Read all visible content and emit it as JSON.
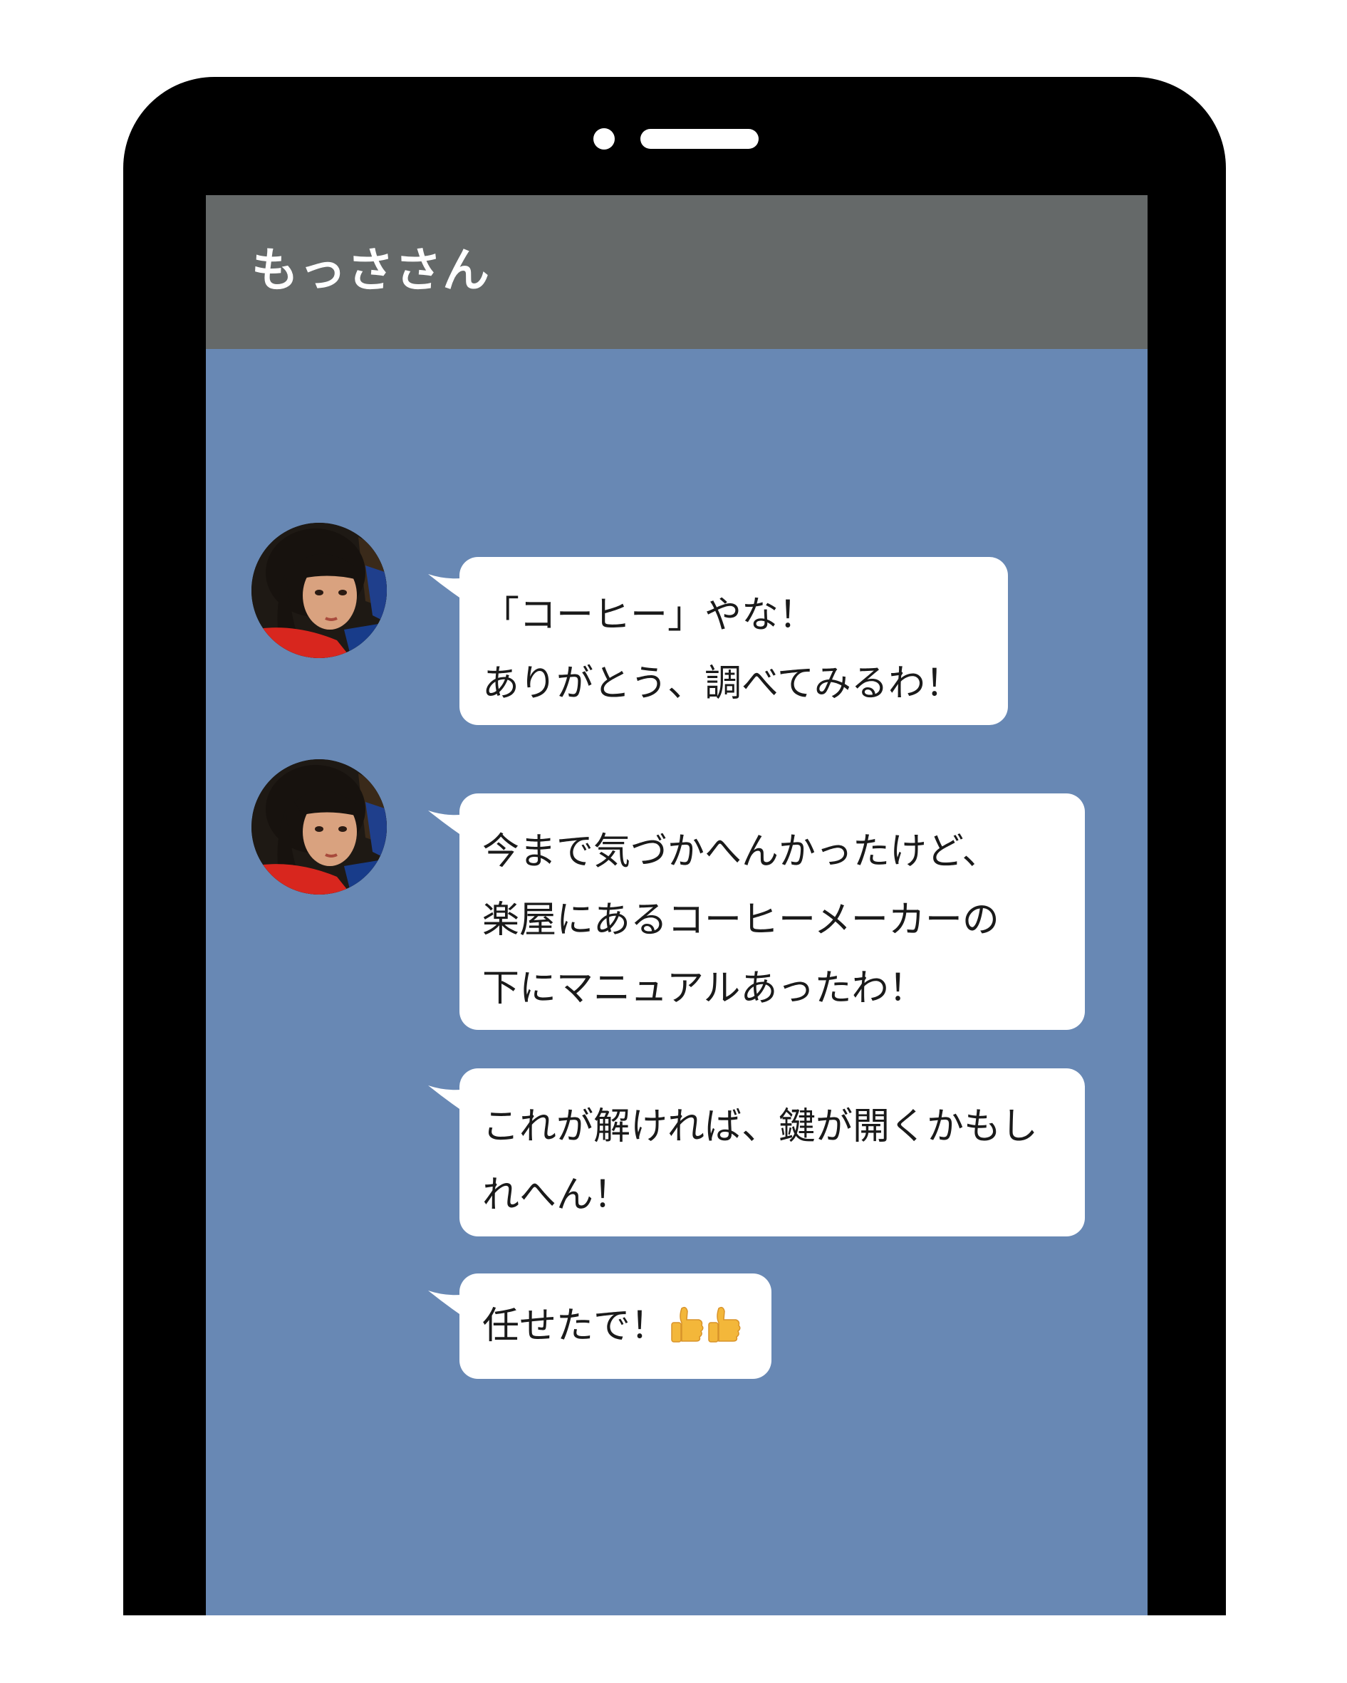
{
  "chat": {
    "contact_name": "もっささん"
  },
  "messages": [
    {
      "sender": "もっささん",
      "avatar": true,
      "lines": [
        "「コーヒー」やな！",
        "ありがとう、調べてみるわ！"
      ]
    },
    {
      "sender": "もっささん",
      "avatar": true,
      "lines": [
        "今まで気づかへんかったけど、",
        "楽屋にあるコーヒーメーカーの",
        "下にマニュアルあったわ！"
      ]
    },
    {
      "sender": "もっささん",
      "avatar": false,
      "lines": [
        "これが解ければ、鍵が開くかもし",
        "れへん！"
      ]
    },
    {
      "sender": "もっささん",
      "avatar": false,
      "lines": [
        "任せたで！"
      ],
      "emoji": [
        "thumbs-up-icon",
        "thumbs-up-icon"
      ]
    }
  ],
  "colors": {
    "device_frame": "#000000",
    "header_bg": "#656969",
    "chat_bg": "#6888b4",
    "bubble_bg": "#ffffff",
    "thumbs_up": "#f3b73a"
  }
}
